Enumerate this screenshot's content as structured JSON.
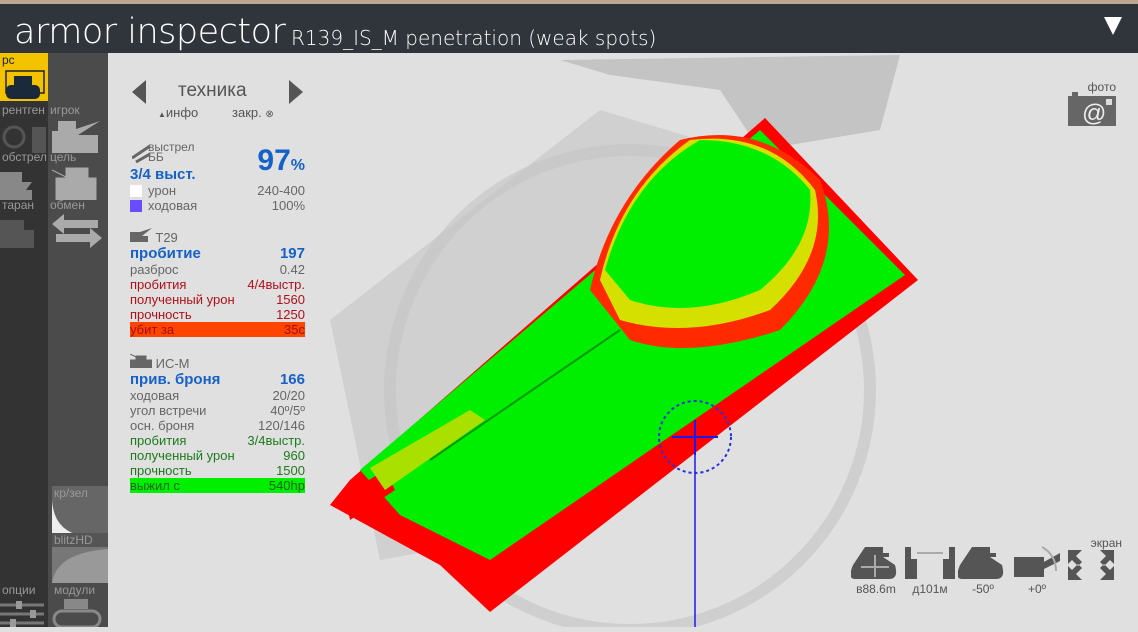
{
  "header": {
    "title": "armor inspector",
    "subtitle": "R139_IS_M penetration (weak spots)"
  },
  "sidebar": {
    "col1": [
      {
        "label": "рс"
      },
      {
        "label": "рентген"
      },
      {
        "label": "обстрел"
      },
      {
        "label": "таран"
      },
      {
        "label": "опции"
      }
    ],
    "col2": [
      {
        "label": "игрок"
      },
      {
        "label": "цель"
      },
      {
        "label": "обмен"
      },
      {
        "label": "кр/зел"
      },
      {
        "label": "blitzHD"
      },
      {
        "label": "модули"
      }
    ]
  },
  "nav": {
    "title": "техника",
    "info": "инфо",
    "close": "закр."
  },
  "shot": {
    "title1": "выстрел",
    "title2": "ББ",
    "hits": "3/4 выст.",
    "percent": "97",
    "percent_sign": "%",
    "damage_label": "урон",
    "damage": "240-400",
    "track_label": "ходовая",
    "track": "100%",
    "damage_color": "#ffffff",
    "track_color": "#6a4cff"
  },
  "attacker": {
    "name": "T29",
    "pen_label": "пробитие",
    "pen": "197",
    "disp_label": "разброс",
    "disp": "0.42",
    "hits_label": "пробития",
    "hits": "4/4выстр.",
    "dmg_label": "полученный урон",
    "dmg": "1560",
    "hp_label": "прочность",
    "hp": "1250",
    "result_label": "убит за",
    "result": "35c"
  },
  "target": {
    "name": "ИС-М",
    "armor_label": "прив. броня",
    "armor": "166",
    "track_label": "ходовая",
    "track": "20/20",
    "angle_label": "угол встречи",
    "angle": "40º/5º",
    "base_label": "осн. броня",
    "base": "120/146",
    "hits_label": "пробития",
    "hits": "3/4выстр.",
    "dmg_label": "полученный урон",
    "dmg": "960",
    "hp_label": "прочность",
    "hp": "1500",
    "result_label": "выжил с",
    "result": "540hp"
  },
  "photo": {
    "label": "фото"
  },
  "controls": {
    "height": "в88.6m",
    "distance": "д101м",
    "hull_angle": "-50º",
    "gun_angle": "+0º",
    "screen": "экран"
  },
  "colors": {
    "accent": "#f3c300",
    "blue": "#1561c8",
    "pen_red": "#ff0000",
    "pen_green": "#00ee00"
  }
}
